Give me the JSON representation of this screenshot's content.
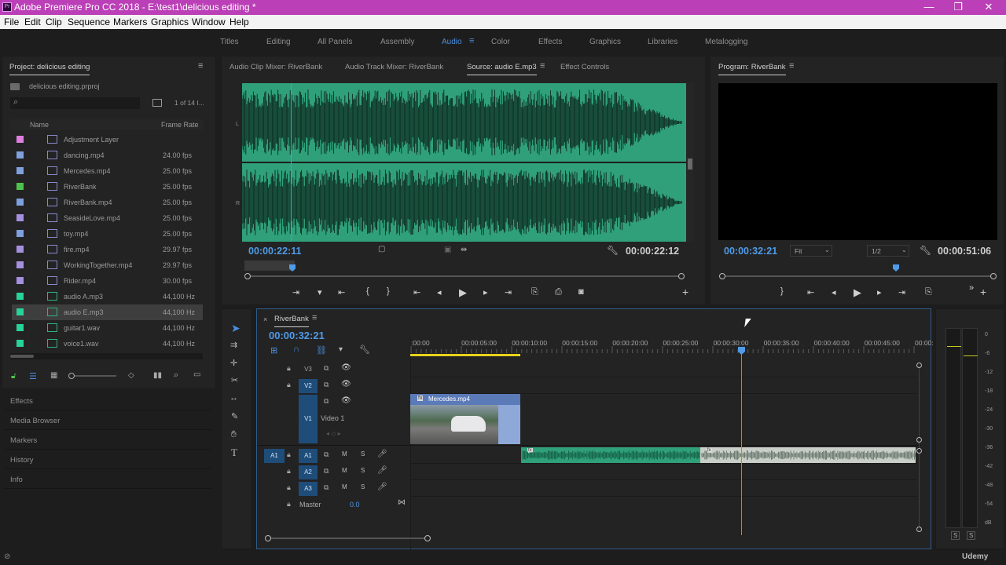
{
  "window": {
    "title": "Adobe Premiere Pro CC 2018 - E:\\test1\\delicious editing *",
    "controls": [
      "—",
      "❐",
      "✕"
    ]
  },
  "menu": [
    "File",
    "Edit",
    "Clip",
    "Sequence",
    "Markers",
    "Graphics",
    "Window",
    "Help"
  ],
  "workspaces": {
    "items": [
      "Titles",
      "Editing",
      "All Panels",
      "Assembly",
      "Audio",
      "Color",
      "Effects",
      "Graphics",
      "Libraries",
      "Metalogging"
    ],
    "active": "Audio"
  },
  "project": {
    "title": "Project: delicious editing",
    "file": "delicious editing.prproj",
    "search_placeholder": "",
    "count": "1 of 14 I...",
    "col_name": "Name",
    "col_rate": "Frame Rate",
    "items": [
      {
        "name": "Adjustment Layer",
        "rate": "",
        "color": "#e07ee0"
      },
      {
        "name": "dancing.mp4",
        "rate": "24.00 fps",
        "color": "#7fa0df"
      },
      {
        "name": "Mercedes.mp4",
        "rate": "25.00 fps",
        "color": "#7fa0df"
      },
      {
        "name": "RiverBank",
        "rate": "25.00 fps",
        "color": "#4dc34d"
      },
      {
        "name": "RiverBank.mp4",
        "rate": "25.00 fps",
        "color": "#7fa0df"
      },
      {
        "name": "SeasideLove.mp4",
        "rate": "25.00 fps",
        "color": "#a590e0"
      },
      {
        "name": "toy.mp4",
        "rate": "25.00 fps",
        "color": "#7fa0df"
      },
      {
        "name": "fire.mp4",
        "rate": "29.97 fps",
        "color": "#a590e0"
      },
      {
        "name": "WorkingTogether.mp4",
        "rate": "29.97 fps",
        "color": "#a590e0"
      },
      {
        "name": "Rider.mp4",
        "rate": "30.00 fps",
        "color": "#a590e0"
      },
      {
        "name": "audio A.mp3",
        "rate": "44,100 Hz",
        "color": "#27d396"
      },
      {
        "name": "audio E.mp3",
        "rate": "44,100 Hz",
        "color": "#27d396"
      },
      {
        "name": "guitar1.wav",
        "rate": "44,100 Hz",
        "color": "#27d396"
      },
      {
        "name": "voice1.wav",
        "rate": "44,100 Hz",
        "color": "#27d396"
      }
    ],
    "selected_index": 11
  },
  "side_panels": [
    "Effects",
    "Media Browser",
    "Markers",
    "History",
    "Info"
  ],
  "source": {
    "tabs": [
      "Audio Clip Mixer: RiverBank",
      "Audio Track Mixer: RiverBank",
      "Source: audio E.mp3",
      "Effect Controls"
    ],
    "active_tab": "Source: audio E.mp3",
    "channel_L": "L",
    "channel_R": "R",
    "timecode_current": "00:00:22:11",
    "timecode_duration": "00:00:22:12",
    "playhead_fraction": 0.11,
    "waveform_color": "#2fa07a"
  },
  "program": {
    "title": "Program: RiverBank",
    "timecode_current": "00:00:32:21",
    "fit": "Fit",
    "quality": "1/2",
    "timecode_duration": "00:00:51:06",
    "playhead_fraction": 0.64
  },
  "timeline": {
    "sequence_name": "RiverBank",
    "timecode": "00:00:32:21",
    "ruler_labels": [
      ":00:00",
      "00:00:05:00",
      "00:00:10:00",
      "00:00:15:00",
      "00:00:20:00",
      "00:00:25:00",
      "00:00:30:00",
      "00:00:35:00",
      "00:00:40:00",
      "00:00:45:00",
      "00:00:"
    ],
    "video_tracks": [
      {
        "id": "V3",
        "name": ""
      },
      {
        "id": "V2",
        "name": ""
      },
      {
        "id": "V1",
        "name": "Video 1"
      }
    ],
    "audio_tracks": [
      {
        "id": "A1",
        "source": "A1"
      },
      {
        "id": "A2"
      },
      {
        "id": "A3"
      }
    ],
    "master_label": "Master",
    "master_value": "0.0",
    "track_buttons": {
      "mute": "M",
      "solo": "S"
    },
    "video_clip": {
      "name": "Mercedes.mp4",
      "fx": "fx"
    },
    "audio_clip_fx": "fx"
  },
  "meter": {
    "db_labels": [
      "0",
      "-6",
      "-12",
      "-18",
      "-24",
      "-30",
      "-36",
      "-42",
      "-48",
      "-54",
      "dB"
    ],
    "solo": [
      "S",
      "S"
    ]
  },
  "watermark": "Udemy"
}
